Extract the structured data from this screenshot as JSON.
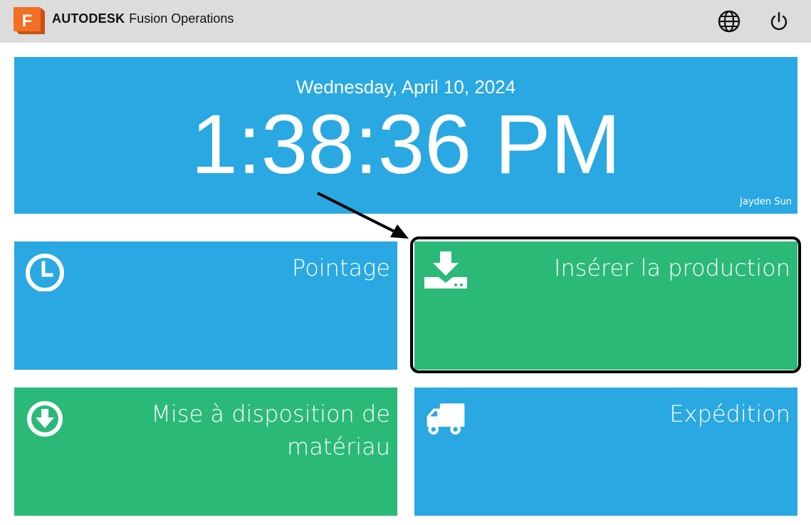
{
  "header": {
    "logo_letter": "F",
    "brand_bold": "AUTODESK",
    "brand_rest": "Fusion Operations",
    "icons": [
      "globe-icon",
      "power-icon"
    ]
  },
  "clock": {
    "date": "Wednesday, April 10, 2024",
    "time": "1:38:36 PM",
    "user": "Jayden Sun"
  },
  "tiles": [
    {
      "label": "Pointage",
      "icon": "clock-icon",
      "color": "#29a8e2"
    },
    {
      "label": "Insérer la production",
      "icon": "download-tray-icon",
      "color": "#2bb978",
      "highlighted": true
    },
    {
      "label_line1": "Mise à disposition de",
      "label_line2": "matériau",
      "icon": "download-circle-icon",
      "color": "#2bb978"
    },
    {
      "label": "Expédition",
      "icon": "truck-icon",
      "color": "#29a8e2"
    }
  ],
  "colors": {
    "topbar": "#dcdcdc",
    "blue": "#29a8e2",
    "green": "#2bb978",
    "logo_orange": "#f36f21"
  }
}
